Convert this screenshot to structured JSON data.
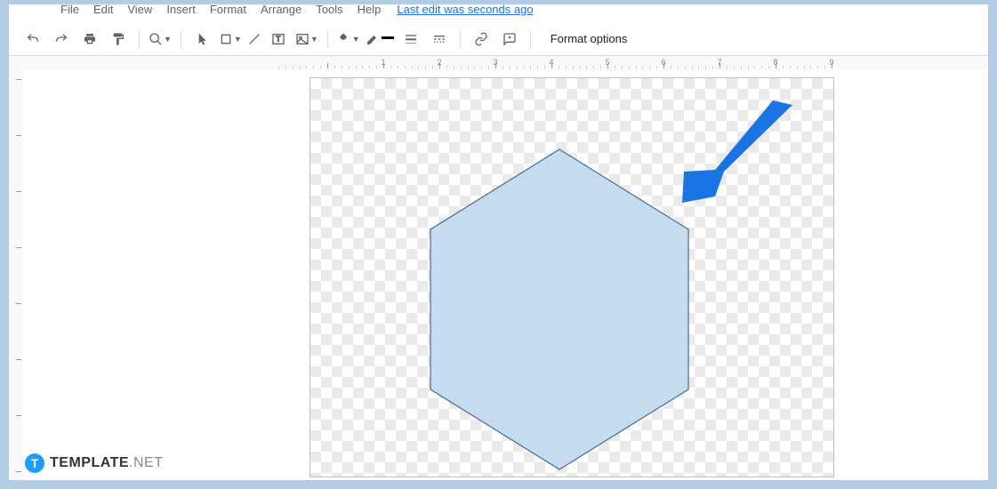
{
  "menu": {
    "items": [
      "File",
      "Edit",
      "View",
      "Insert",
      "Format",
      "Arrange",
      "Tools",
      "Help"
    ],
    "edit_status": "Last edit was seconds ago"
  },
  "toolbar": {
    "format_options": "Format options"
  },
  "ruler": {
    "numbers": [
      "1",
      "2",
      "3",
      "4",
      "5",
      "6",
      "7",
      "8",
      "9"
    ]
  },
  "watermark": {
    "bold": "TEMPLATE",
    "net": ".NET",
    "icon_letter": "T"
  },
  "shapes": {
    "hexagon_fill": "#c5dbef",
    "hexagon_stroke": "#4a6b8a",
    "arrow_fill": "#1b74e4"
  }
}
